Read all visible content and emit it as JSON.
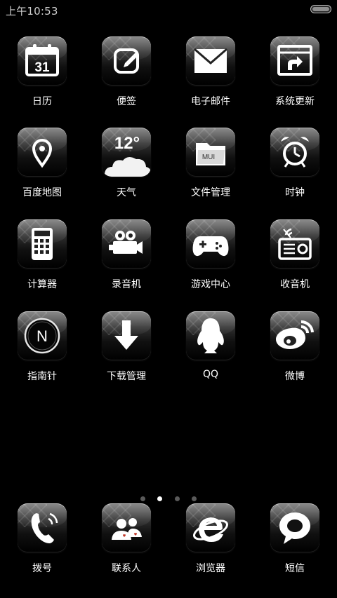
{
  "status_bar": {
    "time": "上午10:53"
  },
  "home": {
    "apps": [
      {
        "label": "日历",
        "icon": "calendar-icon",
        "date": "31"
      },
      {
        "label": "便签",
        "icon": "note-icon"
      },
      {
        "label": "电子邮件",
        "icon": "email-icon"
      },
      {
        "label": "系统更新",
        "icon": "system-update-icon"
      },
      {
        "label": "百度地图",
        "icon": "map-pin-icon"
      },
      {
        "label": "天气",
        "icon": "weather-cloud-icon",
        "temp": "12°"
      },
      {
        "label": "文件管理",
        "icon": "folder-icon",
        "badge": "MUI"
      },
      {
        "label": "时钟",
        "icon": "alarm-clock-icon"
      },
      {
        "label": "计算器",
        "icon": "calculator-icon"
      },
      {
        "label": "录音机",
        "icon": "video-camera-icon"
      },
      {
        "label": "游戏中心",
        "icon": "gamepad-icon"
      },
      {
        "label": "收音机",
        "icon": "radio-icon"
      },
      {
        "label": "指南针",
        "icon": "compass-icon",
        "letter": "N"
      },
      {
        "label": "下载管理",
        "icon": "download-arrow-icon"
      },
      {
        "label": "QQ",
        "icon": "penguin-icon"
      },
      {
        "label": "微博",
        "icon": "weibo-icon"
      }
    ]
  },
  "pager": {
    "count": 4,
    "active": 1
  },
  "dock": {
    "apps": [
      {
        "label": "拨号",
        "icon": "phone-icon"
      },
      {
        "label": "联系人",
        "icon": "contacts-icon"
      },
      {
        "label": "浏览器",
        "icon": "browser-icon"
      },
      {
        "label": "短信",
        "icon": "message-bubble-icon"
      }
    ]
  },
  "colors": {
    "background": "#000000",
    "icon_glyph": "#ffffff",
    "text": "#ffffff",
    "dot_active": "#ffffff",
    "dot_inactive": "#5a5a5a"
  }
}
